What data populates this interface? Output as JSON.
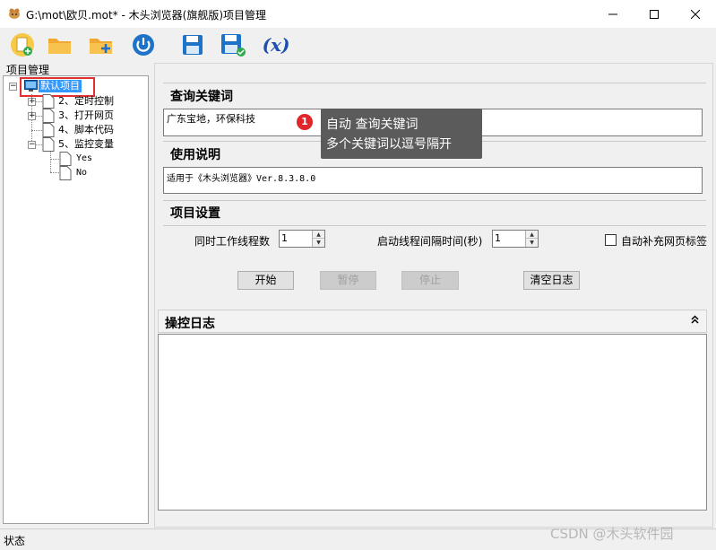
{
  "window": {
    "title": "G:\\mot\\欧贝.mot* - 木头浏览器(旗舰版)项目管理"
  },
  "toolbar": {
    "buttons": [
      "new-project",
      "open-folder",
      "add-folder",
      "power",
      "save",
      "save-as",
      "variables"
    ],
    "variable_label": "(x)"
  },
  "tree": {
    "label": "项目管理",
    "root": "默认项目",
    "items": [
      {
        "label": "2、定时控制",
        "expandable": true
      },
      {
        "label": "3、打开网页",
        "expandable": true
      },
      {
        "label": "4、脚本代码",
        "expandable": false
      },
      {
        "label": "5、监控变量",
        "expandable": true
      }
    ],
    "sub_items": [
      "Yes",
      "No"
    ]
  },
  "query": {
    "title": "查询关键词",
    "value": "广东宝地，环保科技"
  },
  "usage": {
    "title": "使用说明",
    "value": "适用于《木头浏览器》Ver.8.3.8.0"
  },
  "settings": {
    "title": "项目设置",
    "threads_label": "同时工作线程数",
    "threads_value": "1",
    "interval_label": "启动线程间隔时间(秒)",
    "interval_value": "1",
    "autofill_label": "自动补充网页标签"
  },
  "buttons": {
    "start": "开始",
    "pause": "暂停",
    "stop": "停止",
    "clear_log": "清空日志"
  },
  "log": {
    "title": "操控日志"
  },
  "tooltip": {
    "badge": "1",
    "line1": "自动 查询关键词",
    "line2": "多个关键词以逗号隔开"
  },
  "status": {
    "text": "状态"
  },
  "watermark": "CSDN @木头软件园",
  "colors": {
    "selection": "#3399ff",
    "highlight_border": "#e03030",
    "tooltip_bg": "#5b5b5b",
    "badge": "#e0262a"
  }
}
